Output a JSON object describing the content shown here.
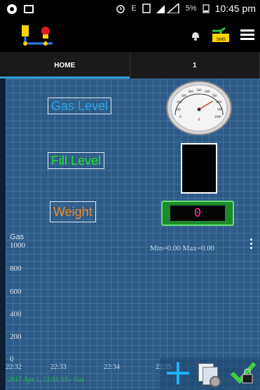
{
  "status_bar": {
    "clock": "10:45 pm",
    "battery": "5%",
    "network": "E",
    "icons": [
      "record-icon",
      "image-icon",
      "alarm-icon",
      "sim-icon",
      "signal-icon",
      "battery-icon"
    ]
  },
  "tabs": [
    "HOME",
    "1"
  ],
  "panels": {
    "gas_label": "Gas Level",
    "fill_label": "Fill Level",
    "weight_label": "Weight",
    "weight_value": "0",
    "gauge_value": "0"
  },
  "gauge": {
    "ticks": [
      "0",
      "100",
      "200",
      "300",
      "400",
      "500",
      "600",
      "700",
      "800",
      "900",
      "1000"
    ]
  },
  "chart_data": {
    "type": "line",
    "series_label": "Gas",
    "yticks": [
      "1000",
      "800",
      "600",
      "400",
      "200",
      "0"
    ],
    "xticks": [
      "22:32",
      "22:33",
      "22:34",
      "22:35"
    ],
    "ylim": [
      0,
      1000
    ],
    "min_text": "Min=0.00",
    "max_text": "Max=0.00",
    "footer": "2017 Apr 1, 22:31:53 - Gas",
    "series": [
      {
        "name": "Gas",
        "values": []
      }
    ]
  },
  "colors": {
    "gas": "#27a7e5",
    "fill": "#23e331",
    "weight": "#f38b26",
    "accent_tab": "#2b9cd8",
    "digit": "#ff2e94"
  }
}
